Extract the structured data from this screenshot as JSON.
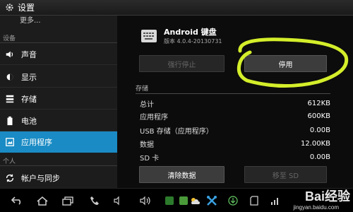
{
  "titlebar": {
    "title": "设置"
  },
  "sidebar": {
    "more": "更多...",
    "section_device": "设备",
    "section_personal": "个人",
    "items": [
      {
        "label": "声音",
        "icon": "volume-icon"
      },
      {
        "label": "显示",
        "icon": "brightness-icon"
      },
      {
        "label": "存储",
        "icon": "storage-icon"
      },
      {
        "label": "电池",
        "icon": "battery-icon"
      },
      {
        "label": "应用程序",
        "icon": "apps-icon",
        "active": true
      },
      {
        "label": "帐户与同步",
        "icon": "sync-icon"
      }
    ]
  },
  "app": {
    "name": "Android 键盘",
    "version": "版本 4.0.4-20130731",
    "force_stop_label": "强行停止",
    "disable_label": "停用"
  },
  "storage": {
    "heading": "存储",
    "rows": [
      {
        "key": "总计",
        "value": "612KB"
      },
      {
        "key": "应用程序",
        "value": "600KB"
      },
      {
        "key": "USB 存储（应用程序）",
        "value": "0.00B"
      },
      {
        "key": "数据",
        "value": "12.00KB"
      },
      {
        "key": "SD 卡",
        "value": "0.00B"
      }
    ],
    "clear_data_label": "清除数据",
    "move_sd_label": "移至 SD"
  },
  "watermark": {
    "brand": "Bai经验",
    "url": "jingyan.baidu.com"
  },
  "colors": {
    "accent": "#1a8bc4",
    "highlight": "#d4ee2a"
  }
}
